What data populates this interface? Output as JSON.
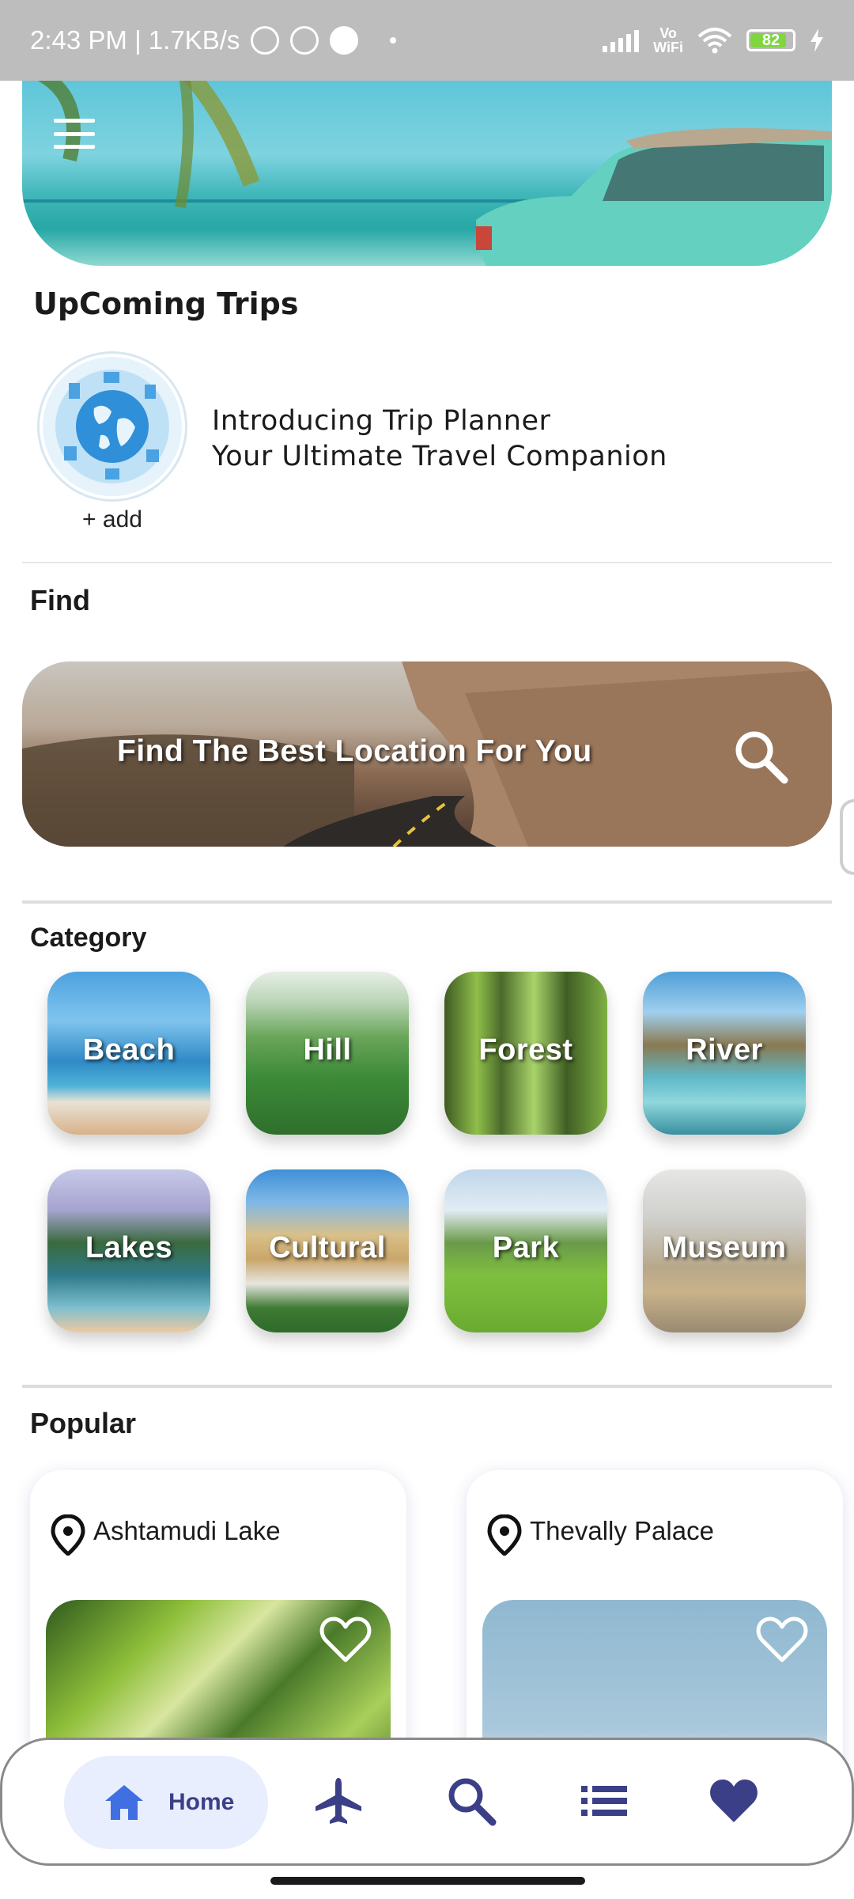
{
  "status_bar": {
    "time_speed": "2:43 PM | 1.7KB/s",
    "vowifi_top": "Vo",
    "vowifi_bottom": "WiFi",
    "battery_level": "82"
  },
  "sections": {
    "upcoming": "UpComing Trips",
    "find": "Find",
    "category": "Category",
    "popular": "Popular"
  },
  "upcoming": {
    "line1": "Introducing Trip Planner",
    "line2": "Your Ultimate Travel Companion",
    "add_label": "+ add"
  },
  "find": {
    "banner_text": "Find The Best Location For You"
  },
  "categories": [
    {
      "label": "Beach"
    },
    {
      "label": "Hill"
    },
    {
      "label": "Forest"
    },
    {
      "label": "River"
    },
    {
      "label": "Lakes"
    },
    {
      "label": "Cultural"
    },
    {
      "label": "Park"
    },
    {
      "label": "Museum"
    }
  ],
  "popular": [
    {
      "name": "Ashtamudi Lake"
    },
    {
      "name": "Thevally Palace"
    }
  ],
  "nav": {
    "home_label": "Home"
  },
  "colors": {
    "accent": "#3b3f87",
    "home_icon": "#3f6fe0",
    "nav_pill": "#e9eefe"
  }
}
